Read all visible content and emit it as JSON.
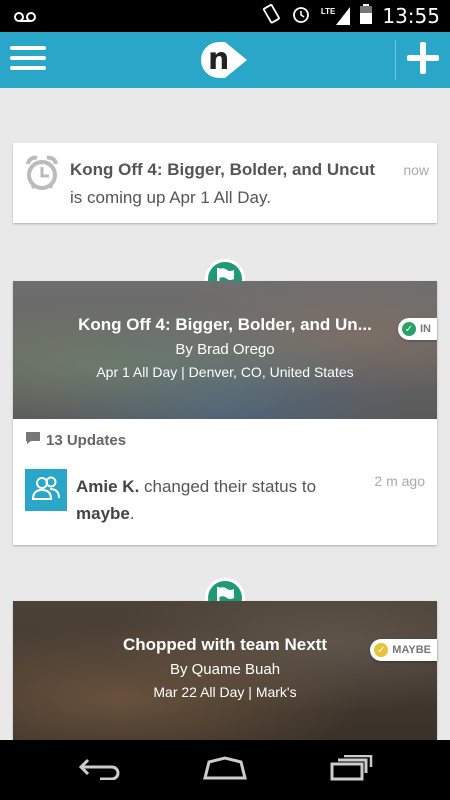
{
  "status_bar": {
    "time": "13:55",
    "network": "LTE"
  },
  "app_bar": {
    "logo_letter": "n",
    "brand_color": "#2aa6c8"
  },
  "reminder": {
    "title": "Kong Off 4: Bigger, Bolder, and Uncut",
    "subtitle": "is coming up Apr 1 All Day.",
    "time": "now"
  },
  "events": [
    {
      "title": "Kong Off 4: Bigger, Bolder, and Un...",
      "organizer": "By Brad Orego",
      "when_where": "Apr 1 All Day | Denver, CO, United States",
      "rsvp": "IN",
      "rsvp_color": "#2aa06a",
      "updates": "13 Updates",
      "activity": {
        "name": "Amie K.",
        "action": " changed their status to ",
        "status": "maybe",
        "end": ".",
        "ago": "2 m ago"
      }
    },
    {
      "title": "Chopped with team Nextt",
      "organizer": "By Quame Buah",
      "when_where": "Mar 22 All Day | Mark's",
      "rsvp": "MAYBE",
      "rsvp_color": "#e8c23a"
    }
  ],
  "colors": {
    "accent": "#2aa6c8",
    "flag_badge": "#1f9a75",
    "background": "#e9e9e9"
  }
}
